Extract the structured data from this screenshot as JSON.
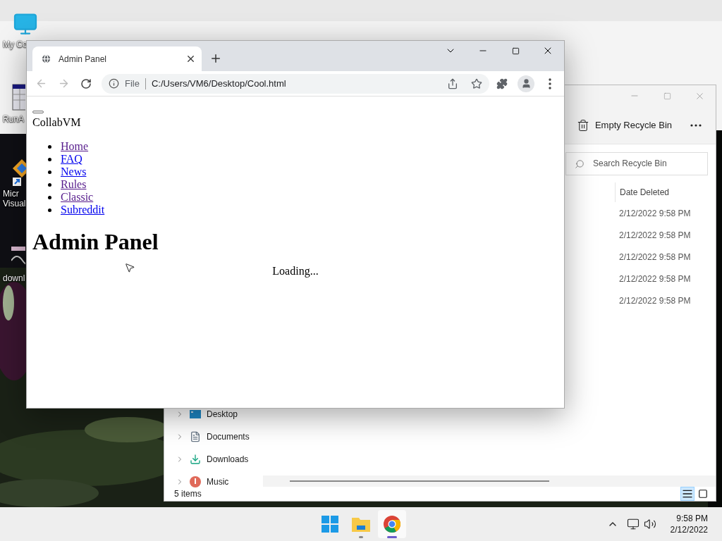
{
  "desktop": {
    "icons": [
      {
        "kind": "computer",
        "lines": [
          "My Co"
        ]
      },
      {
        "kind": "calendar",
        "lines": [
          "RunA"
        ]
      },
      {
        "kind": "studio",
        "lines": [
          "Micr",
          "Visual"
        ]
      },
      {
        "kind": "media",
        "lines": [
          "downl"
        ]
      }
    ]
  },
  "browser": {
    "tab": {
      "title": "Admin Panel",
      "selected": true
    },
    "address": {
      "scheme": "File",
      "url": "C:/Users/VM6/Desktop/Cool.html"
    },
    "page": {
      "brand": "CollabVM",
      "nav": [
        {
          "label": "Home",
          "visited": true
        },
        {
          "label": "FAQ",
          "visited": false
        },
        {
          "label": "News",
          "visited": false
        },
        {
          "label": "Rules",
          "visited": true
        },
        {
          "label": "Classic",
          "visited": true
        },
        {
          "label": "Subreddit",
          "visited": false
        }
      ],
      "heading": "Admin Panel",
      "status": "Loading..."
    }
  },
  "explorer": {
    "command": "Empty Recycle Bin",
    "search": {
      "placeholder": "Search Recycle Bin"
    },
    "columns": [
      "Date Deleted"
    ],
    "rows": [
      "2/12/2022 9:58 PM",
      "2/12/2022 9:58 PM",
      "2/12/2022 9:58 PM",
      "2/12/2022 9:58 PM",
      "2/12/2022 9:58 PM"
    ],
    "nav": [
      {
        "kind": "desktop",
        "label": "Desktop"
      },
      {
        "kind": "documents",
        "label": "Documents"
      },
      {
        "kind": "downloads",
        "label": "Downloads"
      },
      {
        "kind": "music",
        "label": "Music"
      }
    ],
    "status": "5 items",
    "views": [
      {
        "kind": "details",
        "selected": true
      },
      {
        "kind": "tiles",
        "selected": false
      }
    ]
  },
  "taskbar": {
    "apps": [
      {
        "kind": "start",
        "running": false,
        "active": false
      },
      {
        "kind": "explorer",
        "running": true,
        "active": false
      },
      {
        "kind": "chrome",
        "running": true,
        "active": true
      }
    ],
    "clock": {
      "time": "9:58 PM",
      "date": "2/12/2022"
    }
  }
}
